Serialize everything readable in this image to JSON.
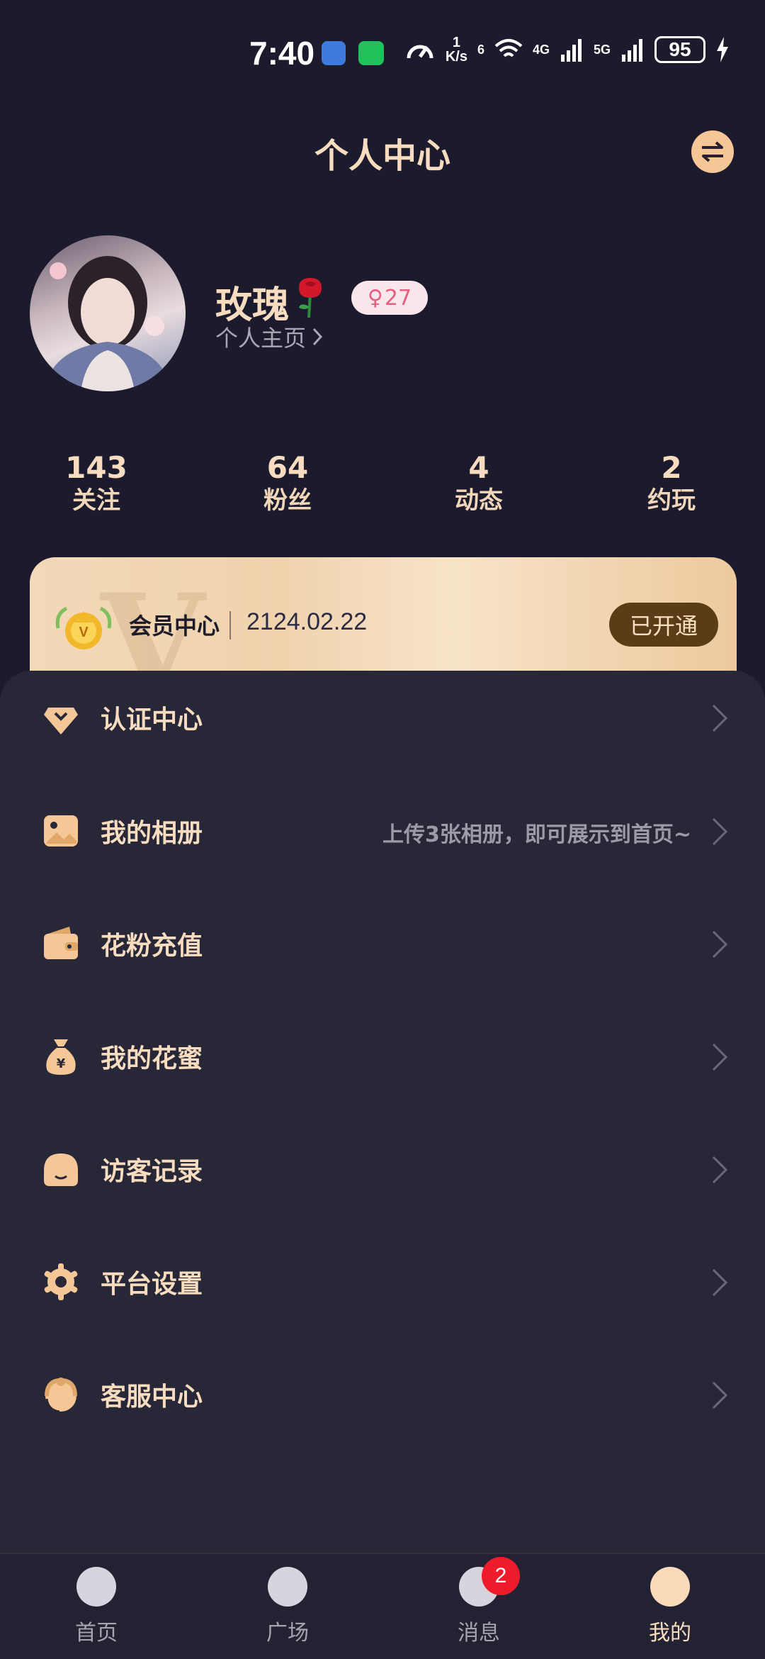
{
  "status_bar": {
    "time": "7:40",
    "net_speed_value": "1",
    "net_speed_unit": "K/s",
    "wifi_label": "6",
    "sim1_label": "4G",
    "sim2_label": "5G",
    "battery": "95"
  },
  "header": {
    "title": "个人中心"
  },
  "profile": {
    "nickname": "玫瑰",
    "gender_symbol": "♀",
    "age": "27",
    "homepage_link": "个人主页"
  },
  "stats": [
    {
      "value": "143",
      "label": "关注"
    },
    {
      "value": "64",
      "label": "粉丝"
    },
    {
      "value": "4",
      "label": "动态"
    },
    {
      "value": "2",
      "label": "约玩"
    }
  ],
  "vip": {
    "watermark": "V",
    "title": "会员中心",
    "expiry": "2124.02.22",
    "status": "已开通"
  },
  "menu": [
    {
      "label": "认证中心",
      "hint": "",
      "icon": "diamond-icon"
    },
    {
      "label": "我的相册",
      "hint": "上传3张相册，即可展示到首页~",
      "icon": "photo-album-icon"
    },
    {
      "label": "花粉充值",
      "hint": "",
      "icon": "wallet-icon"
    },
    {
      "label": "我的花蜜",
      "hint": "",
      "icon": "money-bag-icon"
    },
    {
      "label": "访客记录",
      "hint": "",
      "icon": "visitor-icon"
    },
    {
      "label": "平台设置",
      "hint": "",
      "icon": "gear-icon"
    },
    {
      "label": "客服中心",
      "hint": "",
      "icon": "customer-service-icon"
    }
  ],
  "bottom_nav": {
    "items": [
      {
        "label": "首页",
        "active": false
      },
      {
        "label": "广场",
        "active": false
      },
      {
        "label": "消息",
        "active": false
      },
      {
        "label": "我的",
        "active": true
      }
    ],
    "message_badge": "2"
  },
  "colors": {
    "background": "#1b1b2d",
    "panel": "#272738",
    "accent": "#f7dcc0",
    "vip_button": "#5a3d17",
    "badge_red": "#ee1c2b"
  }
}
